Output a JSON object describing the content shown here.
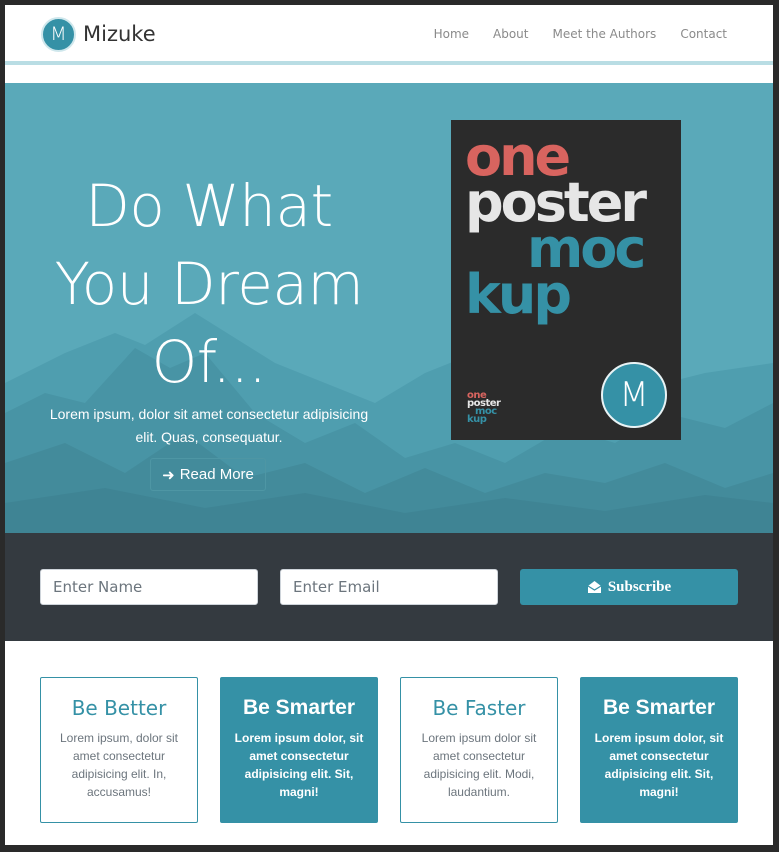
{
  "brand": {
    "logo_letter": "M",
    "name": "Mizuke"
  },
  "nav": {
    "items": [
      "Home",
      "About",
      "Meet the Authors",
      "Contact"
    ]
  },
  "hero": {
    "title_lines": [
      "Do What",
      "You Dream",
      "Of..."
    ],
    "text": "Lorem ipsum, dolor sit amet consectetur adipisicing elit. Quas, consequatur.",
    "read_more_label": "Read More",
    "read_more_icon": "arrow-right-icon"
  },
  "poster": {
    "line1": "one",
    "line2": "poster",
    "line3": "moc",
    "line4": "kup",
    "small1": "one",
    "small2": "poster",
    "small3": "moc",
    "small4": "kup",
    "badge_letter": "M",
    "colors": {
      "one": "#d8645f",
      "poster": "#e6e6e6",
      "mockup": "#3591a6"
    }
  },
  "subscribe": {
    "name_placeholder": "Enter Name",
    "email_placeholder": "Enter Email",
    "button_label": "Subscribe",
    "button_icon": "envelope-open-icon"
  },
  "features": [
    {
      "title": "Be Better",
      "text": "Lorem ipsum, dolor sit amet consectetur adipisicing elit. In, accusamus!",
      "style": "outline"
    },
    {
      "title": "Be Smarter",
      "text": "Lorem ipsum dolor, sit amet consectetur adipisicing elit. Sit, magni!",
      "style": "filled"
    },
    {
      "title": "Be Faster",
      "text": "Lorem ipsum dolor sit amet consectetur adipisicing elit. Modi, laudantium.",
      "style": "outline"
    },
    {
      "title": "Be Smarter",
      "text": "Lorem ipsum dolor, sit amet consectetur adipisicing elit. Sit, magni!",
      "style": "filled"
    }
  ],
  "colors": {
    "accent": "#3591a6",
    "dark": "#343a40",
    "hero_bg": "#5aa9b9"
  }
}
